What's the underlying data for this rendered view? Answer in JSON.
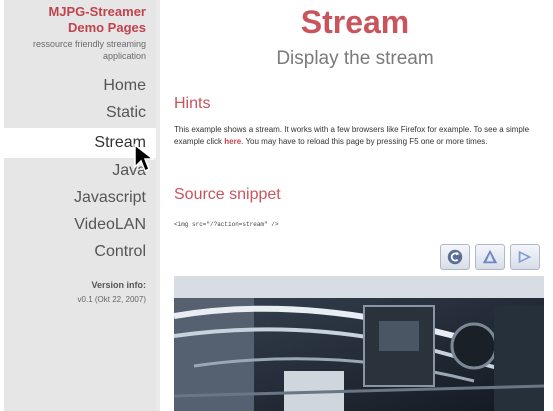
{
  "sidebar": {
    "logo_line1": "MJPG-Streamer",
    "logo_line2": "Demo Pages",
    "tagline": "ressource friendly streaming application",
    "nav": {
      "home": "Home",
      "static": "Static",
      "stream": "Stream",
      "java": "Java",
      "javascript": "Javascript",
      "videolan": "VideoLAN",
      "control": "Control"
    },
    "version_label": "Version info:",
    "version_value": "v0.1 (Okt 22, 2007)"
  },
  "main": {
    "title": "Stream",
    "subtitle": "Display the stream",
    "hints_heading": "Hints",
    "hints_text_before": "This example shows a stream. It works with a few browsers like Firefox for example. To see a simple example click ",
    "hints_link": "here",
    "hints_text_after": ". You may have to reload this page by pressing F5 one or more times.",
    "source_heading": "Source snippet",
    "code_snippet": "<img src=\"/?action=stream\" />"
  },
  "toolbar": {
    "buttons": [
      "reload-icon",
      "rotate-icon",
      "play-icon"
    ]
  },
  "colors": {
    "accent": "#c9545c",
    "sidebar_bg": "#e6e6e6",
    "text_muted": "#7a7a7a"
  }
}
